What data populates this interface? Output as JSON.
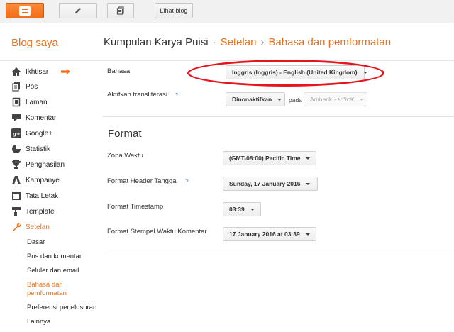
{
  "topbar": {
    "view_blog_label": "Lihat blog"
  },
  "header": {
    "my_blogs": "Blog saya",
    "blog_name": "Kumpulan Karya Puisi",
    "sep1": "·",
    "section": "Setelan",
    "sep2": "›",
    "page": "Bahasa dan pemformatan"
  },
  "sidebar": {
    "items": [
      {
        "label": "Ikhtisar",
        "icon": "home-icon"
      },
      {
        "label": "Pos",
        "icon": "posts-icon"
      },
      {
        "label": "Laman",
        "icon": "pages-icon"
      },
      {
        "label": "Komentar",
        "icon": "comment-icon"
      },
      {
        "label": "Google+",
        "icon": "googleplus-icon"
      },
      {
        "label": "Statistik",
        "icon": "stats-icon"
      },
      {
        "label": "Penghasilan",
        "icon": "trophy-icon"
      },
      {
        "label": "Kampanye",
        "icon": "campaign-icon"
      },
      {
        "label": "Tata Letak",
        "icon": "layout-icon"
      },
      {
        "label": "Template",
        "icon": "template-icon"
      },
      {
        "label": "Setelan",
        "icon": "wrench-icon"
      }
    ],
    "subitems": [
      "Dasar",
      "Pos dan komentar",
      "Seluler dan email",
      "Bahasa dan pemformatan",
      "Preferensi penelusuran",
      "Lainnya"
    ]
  },
  "language": {
    "label": "Bahasa",
    "value": "Inggris (Inggris) - English (United Kingdom)",
    "translit_label": "Aktifkan transliterasi",
    "help": "?",
    "translit_value": "Dinonaktifkan",
    "pada": "pada",
    "translit_lang": "Amharik - አማርኛ"
  },
  "format": {
    "heading": "Format",
    "timezone_label": "Zona Waktu",
    "timezone_value": "(GMT-08:00) Pacific Time",
    "date_header_label": "Format Header Tanggal",
    "date_header_help": "?",
    "date_header_value": "Sunday, 17 January 2016",
    "timestamp_label": "Format Timestamp",
    "timestamp_value": "03:39",
    "comment_ts_label": "Format Stempel Waktu Komentar",
    "comment_ts_value": "17 January 2016 at 03:39"
  },
  "colors": {
    "accent": "#e8711c",
    "annotation": "#e8141b"
  }
}
